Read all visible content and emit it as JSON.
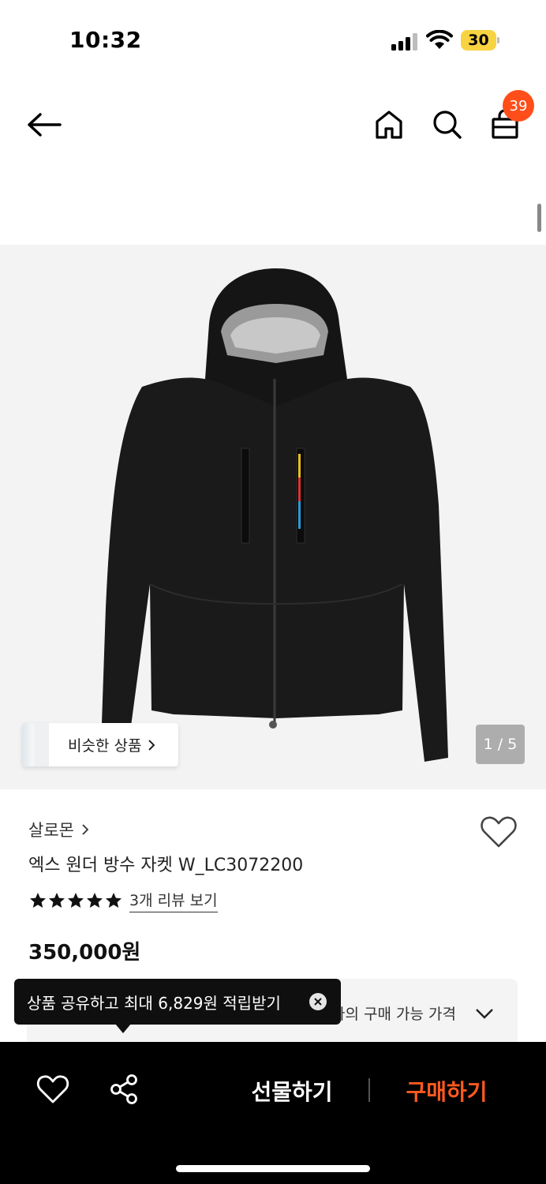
{
  "status_bar": {
    "time": "10:32",
    "battery_level": "30",
    "icons": [
      "cellular-signal-icon",
      "wifi-icon",
      "battery-icon"
    ]
  },
  "nav": {
    "icons": [
      "arrow-left-icon",
      "home-icon",
      "search-icon",
      "shopping-bag-icon"
    ],
    "cart_count": "39"
  },
  "gallery": {
    "similar_label": "비슷한 상품",
    "page_counter": "1 / 5"
  },
  "product": {
    "brand": "살로몬",
    "title": "엑스 원더 방수 자켓 W_LC3072200",
    "rating_stars": 5,
    "review_link": "3개 리뷰 보기",
    "price": "350,000원"
  },
  "price_box": {
    "label": "나의 구매 가능 가격"
  },
  "tooltip": {
    "text": "상품 공유하고 최대 6,829원 적립받기"
  },
  "bottom_bar": {
    "gift_label": "선물하기",
    "buy_label": "구매하기"
  },
  "colors": {
    "accent": "#ff5a1f",
    "badge": "#ff4e1a",
    "battery": "#f7d341",
    "bottom_bar_bg": "#000000"
  }
}
